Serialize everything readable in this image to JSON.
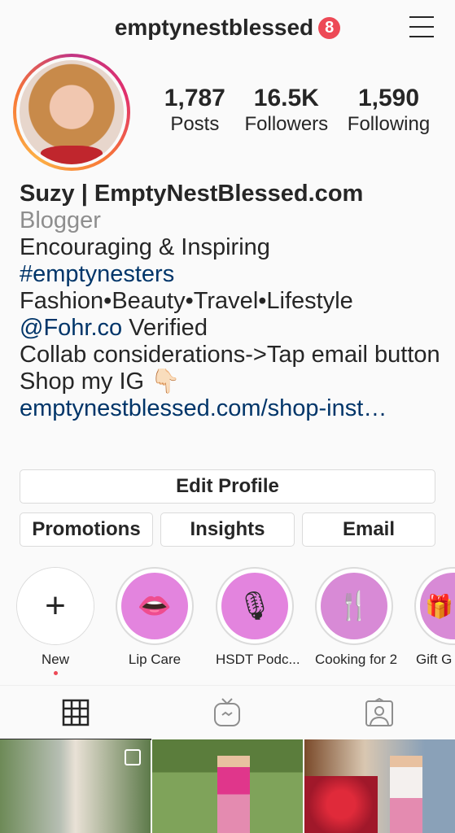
{
  "header": {
    "username": "emptynestblessed",
    "notification_count": "8"
  },
  "stats": [
    {
      "value": "1,787",
      "label": "Posts"
    },
    {
      "value": "16.5K",
      "label": "Followers"
    },
    {
      "value": "1,590",
      "label": "Following"
    }
  ],
  "bio": {
    "name": "Suzy | EmptyNestBlessed.com",
    "category": "Blogger",
    "line1": "Encouraging & Inspiring",
    "hashtag": "#emptynesters",
    "line3": "Fashion•Beauty•Travel•Lifestyle",
    "mention": "@Fohr.co",
    "mention_suffix": " Verified",
    "line5": "Collab considerations->Tap email button",
    "line6": "Shop my IG 👇🏻",
    "website": "emptynestblessed.com/shop-inst…"
  },
  "buttons": {
    "edit_profile": "Edit Profile",
    "promotions": "Promotions",
    "insights": "Insights",
    "email": "Email"
  },
  "highlights": [
    {
      "label": "New",
      "icon": "plus-icon",
      "glyph": "+"
    },
    {
      "label": "Lip Care",
      "icon": "lips-icon",
      "glyph": "👄"
    },
    {
      "label": "HSDT Podc...",
      "icon": "microphone-icon",
      "glyph": "🎙"
    },
    {
      "label": "Cooking for 2",
      "icon": "utensils-icon",
      "glyph": "🍴"
    },
    {
      "label": "Gift G",
      "icon": "gift-icon",
      "glyph": "🎁"
    }
  ],
  "colors": {
    "accent_link": "#003569",
    "badge": "#ed4956",
    "highlight_fill": "#e384de"
  }
}
